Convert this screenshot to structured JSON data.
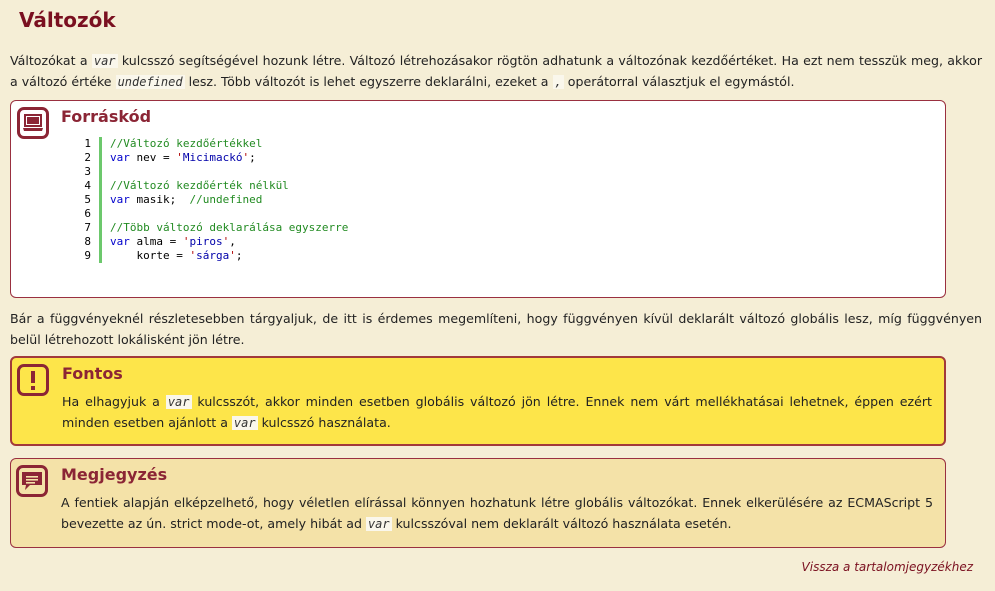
{
  "page": {
    "title": "Változók",
    "intro": {
      "t1": "Változókat a ",
      "kw1": "var",
      "t2": " kulcsszó segítségével hozunk létre. Változó létrehozásakor rögtön adhatunk a változónak kezdőértéket. Ha ezt nem tesszük meg, akkor a változó értéke ",
      "kw2": "undefined",
      "t3": " lesz. Több változót is lehet egyszerre deklarálni, ezeket a ",
      "kw3": ",",
      "t4": " operátorral választjuk el egymástól."
    },
    "middle_text": "Bár a függvényeknél részletesebben tárgyaljuk, de itt is érdemes megemlíteni, hogy függvényen kívül deklarált változó globális lesz, míg függvényen belül létrehozott lokálisként jön létre.",
    "footer_link": "Vissza a tartalomjegyzékhez"
  },
  "source_box": {
    "title": "Forráskód",
    "icon": "laptop-icon",
    "lines": [
      {
        "n": "1",
        "parts": [
          {
            "t": "//Változó kezdőértékkel",
            "c": "comment"
          }
        ]
      },
      {
        "n": "2",
        "parts": [
          {
            "t": "var",
            "c": "kw"
          },
          {
            "t": " nev = ",
            "c": ""
          },
          {
            "t": "'",
            "c": "q"
          },
          {
            "t": "Micimackó",
            "c": "str"
          },
          {
            "t": "'",
            "c": "q"
          },
          {
            "t": ";",
            "c": ""
          }
        ]
      },
      {
        "n": "3",
        "parts": []
      },
      {
        "n": "4",
        "parts": [
          {
            "t": "//Változó kezdőérték nélkül",
            "c": "comment"
          }
        ]
      },
      {
        "n": "5",
        "parts": [
          {
            "t": "var",
            "c": "kw"
          },
          {
            "t": " masik;  ",
            "c": ""
          },
          {
            "t": "//undefined",
            "c": "comment"
          }
        ]
      },
      {
        "n": "6",
        "parts": []
      },
      {
        "n": "7",
        "parts": [
          {
            "t": "//Több változó deklarálása egyszerre",
            "c": "comment"
          }
        ]
      },
      {
        "n": "8",
        "parts": [
          {
            "t": "var",
            "c": "kw"
          },
          {
            "t": " alma = ",
            "c": ""
          },
          {
            "t": "'",
            "c": "q"
          },
          {
            "t": "piros",
            "c": "str"
          },
          {
            "t": "'",
            "c": "q"
          },
          {
            "t": ",",
            "c": ""
          }
        ]
      },
      {
        "n": "9",
        "parts": [
          {
            "t": "    korte = ",
            "c": ""
          },
          {
            "t": "'",
            "c": "q"
          },
          {
            "t": "sárga",
            "c": "str"
          },
          {
            "t": "'",
            "c": "q"
          },
          {
            "t": ";",
            "c": ""
          }
        ]
      }
    ]
  },
  "important_box": {
    "title": "Fontos",
    "icon": "exclamation-icon",
    "t1": "Ha elhagyjuk a ",
    "kw1": "var",
    "t2": " kulcsszót, akkor minden esetben globális változó jön létre. Ennek nem várt mellékhatásai lehetnek, éppen ezért minden esetben ajánlott a ",
    "kw2": "var",
    "t3": " kulcsszó használata."
  },
  "note_box": {
    "title": "Megjegyzés",
    "icon": "speech-bubble-icon",
    "t1": "A fentiek alapján elképzelhető, hogy véletlen elírással könnyen hozhatunk létre globális változókat. Ennek elkerülésére az ECMAScript 5 bevezette az ún. strict mode-ot, amely hibát ad ",
    "kw1": "var",
    "t2": " kulcsszóval nem deklarált változó használata esetén."
  },
  "colors": {
    "heading": "#7a1020",
    "background": "#f5eed6",
    "important_bg": "#fde54a",
    "note_bg": "#f4e2a8",
    "code_comment": "#228b22",
    "code_keyword": "#0000cc"
  }
}
